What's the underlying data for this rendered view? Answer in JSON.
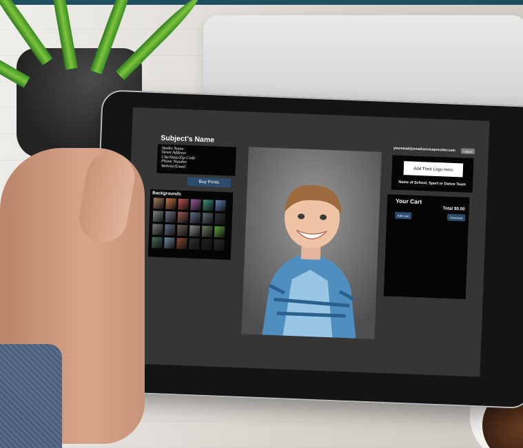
{
  "subject_panel": {
    "subject_name": "Subject's Name",
    "studio_lines": [
      "Studio Name",
      "Street Address",
      "City/State/Zip Code",
      "Phone Number",
      "Website/Email"
    ],
    "buy_prints_label": "Buy Prints"
  },
  "backgrounds": {
    "title": "Backgrounds",
    "swatch_colors": [
      "#a97a5f",
      "#c9734c",
      "#c5514e",
      "#9b5aa0",
      "#3c8f7b",
      "#5f7fb5",
      "#7a8a87",
      "#6c6f86",
      "#9b5b4f",
      "#5f6c7c",
      "#5b6670",
      "#2d2f32",
      "#7b7b7b",
      "#5f6e86",
      "#6e5e4e",
      "#8a8a8a",
      "#6a7a5a",
      "#5aa03c",
      "#4a6a5a",
      "#6b8aa0",
      "#8a4a2f",
      "#2f2f2f",
      "#1e1e1e",
      "#2a2a2a"
    ]
  },
  "photo": {
    "description_icon": "portrait-photo-icon"
  },
  "account": {
    "email": "youremail@emailserviceprovider.com",
    "logout_label": "Logout"
  },
  "logo": {
    "add_logo_label": "Add Their Logo Here",
    "school_name": "Name of School, Sport or Dance Team"
  },
  "cart": {
    "title": "Your Cart",
    "total": "Total $0.00",
    "edit_cart_label": "Edit Cart",
    "checkout_label": "Checkout"
  },
  "colors": {
    "top_bar": "#1f4f61",
    "screen_bg": "#353535",
    "button_blue": "#2c4c6e"
  }
}
